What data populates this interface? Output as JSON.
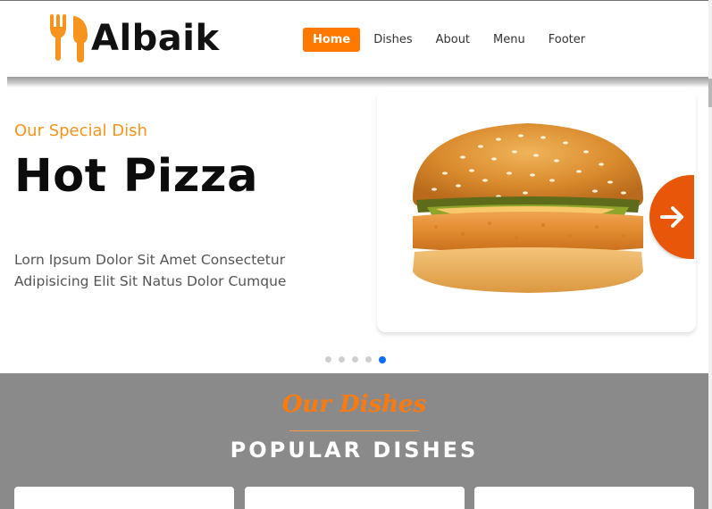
{
  "brand": {
    "name": "Albaik",
    "accent": "#ff7800"
  },
  "nav": {
    "items": [
      {
        "label": "Home",
        "active": true
      },
      {
        "label": "Dishes",
        "active": false
      },
      {
        "label": "About",
        "active": false
      },
      {
        "label": "Menu",
        "active": false
      },
      {
        "label": "Footer",
        "active": false
      }
    ]
  },
  "hero": {
    "subtitle": "Our Special Dish",
    "title": "Hot Pizza",
    "description": "Lorn Ipsum Dolor Sit Amet Consectetur Adipisicing Elit Sit Natus Dolor Cumque",
    "image_icon": "burger-image",
    "next_icon": "arrow-right-icon",
    "slides_total": 5,
    "active_slide": 5
  },
  "dishes": {
    "script_title": "Our Dishes",
    "title": "POPULAR DISHES",
    "background": "#8a8a8a"
  }
}
